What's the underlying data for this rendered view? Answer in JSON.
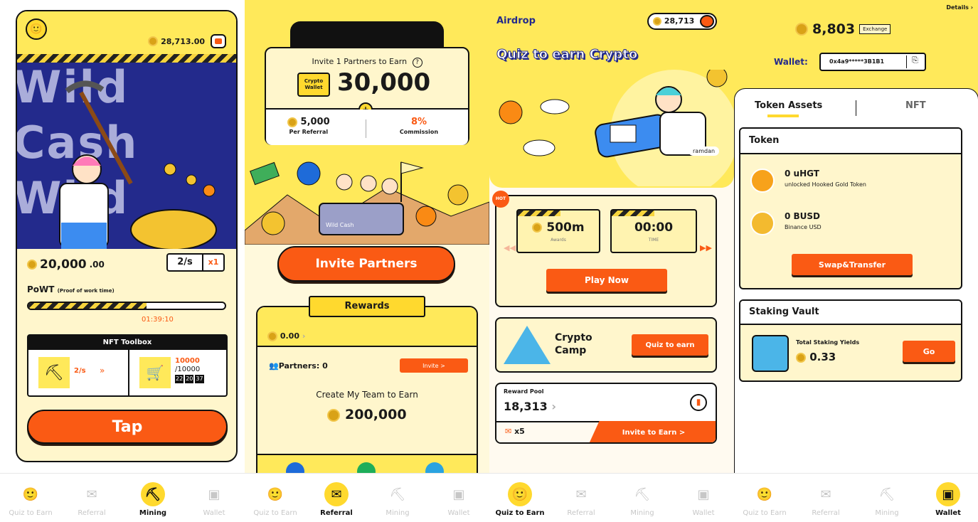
{
  "mining": {
    "balance_top": "28,713.00",
    "hero_text": "Wild Cash Wild",
    "balance": "20,000",
    "balance_decimals": ".00",
    "rate": "2/s",
    "multiplier": "x1",
    "powt_label": "PoWT",
    "powt_sub": "(Proof of work time)",
    "progress": 0.6,
    "timer": "01:39:10",
    "toolbox_title": "NFT Toolbox",
    "tool_rate": "2/s",
    "cart_value": "10000",
    "cart_max": "/10000",
    "cart_time": [
      "22",
      "20",
      "37"
    ],
    "tap_label": "Tap"
  },
  "referral": {
    "invite_title": "Invite 1 Partners to Earn",
    "wallet_badge": "Crypto Wallet",
    "amount": "30,000",
    "per_referral_value": "5,000",
    "per_referral_label": "Per Referral",
    "commission_value": "8%",
    "commission_label": "Commission",
    "cart_text": "Wild Cash",
    "invite_button": "Invite Partners",
    "rewards_title": "Rewards",
    "rewards_value": "0.00",
    "partners_label": "Partners: 0",
    "invite_small": "Invite >",
    "team_text": "Create My Team to Earn",
    "team_amount": "200,000"
  },
  "quiz": {
    "airdrop": "Airdrop",
    "balance": "28,713",
    "title": "Quiz to earn Crypto",
    "user_tag": "ramdan",
    "hot": "HOT",
    "awards_value": "500m",
    "awards_label": "Awards",
    "time_value": "00:00",
    "time_label": "TIME",
    "play_now": "Play Now",
    "camp_title": "Crypto Camp",
    "quiz_btn": "Quiz to earn",
    "pool_label": "Reward Pool",
    "pool_value": "18,313",
    "ticket_count": "x5",
    "invite_earn": "Invite to Earn >"
  },
  "wallet": {
    "details": "Details",
    "balance": "8,803",
    "exchange": "Exchange",
    "wallet_label": "Wallet:",
    "address": "0x4a9*****3B1B1",
    "tab_assets": "Token Assets",
    "tab_nft": "NFT",
    "token_section": "Token",
    "tokens": [
      {
        "amount": "0 uHGT",
        "name": "unlocked Hooked Gold Token",
        "color": "#f7a21b"
      },
      {
        "amount": "0 BUSD",
        "name": "Binance USD",
        "color": "#f3ba2f"
      }
    ],
    "swap_btn": "Swap&Transfer",
    "vault_title": "Staking Vault",
    "yields_label": "Total Staking Yields",
    "yields_value": "0.33",
    "go_btn": "Go"
  },
  "nav_groups": [
    {
      "active": "Mining"
    },
    {
      "active": "Referral"
    },
    {
      "active": "Quiz to Earn"
    },
    {
      "active": "Wallet"
    }
  ],
  "nav_labels": [
    "Quiz to Earn",
    "Referral",
    "Mining",
    "Wallet"
  ],
  "colors": {
    "accent": "#fa5a14",
    "yellow": "#ffe95a",
    "cream": "#fff6cc",
    "navy": "#232a8c"
  }
}
